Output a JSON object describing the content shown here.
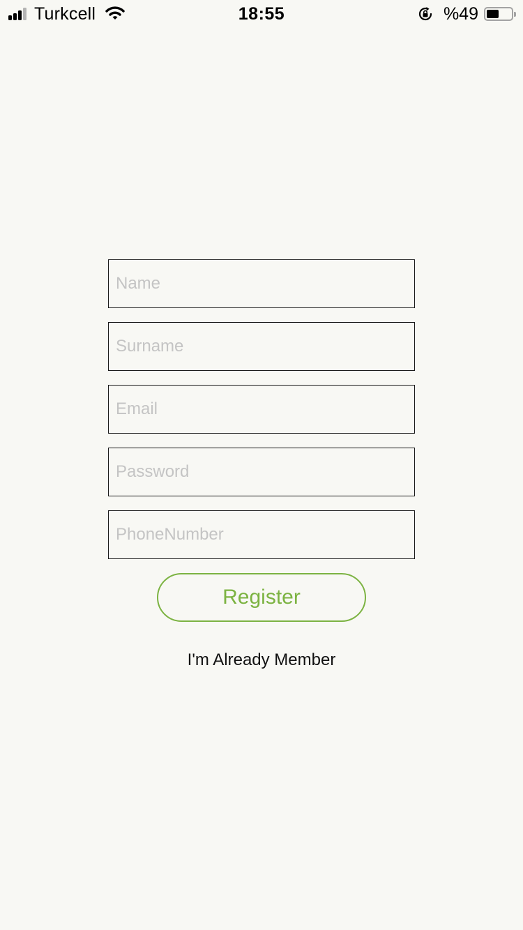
{
  "status_bar": {
    "carrier": "Turkcell",
    "time": "18:55",
    "battery_percent": "%49",
    "battery_level": 0.49,
    "signal_bars_active": 3,
    "signal_bars_total": 4,
    "icons": [
      "signal-icon",
      "wifi-icon",
      "rotation-lock-icon",
      "battery-icon"
    ]
  },
  "form": {
    "name_placeholder": "Name",
    "surname_placeholder": "Surname",
    "email_placeholder": "Email",
    "password_placeholder": "Password",
    "phone_placeholder": "PhoneNumber",
    "register_label": "Register",
    "already_member_label": "I'm Already Member"
  },
  "colors": {
    "background": "#f8f8f4",
    "accent": "#7cb342",
    "field_border": "#1a1a1a",
    "placeholder": "#c4c4c4"
  }
}
